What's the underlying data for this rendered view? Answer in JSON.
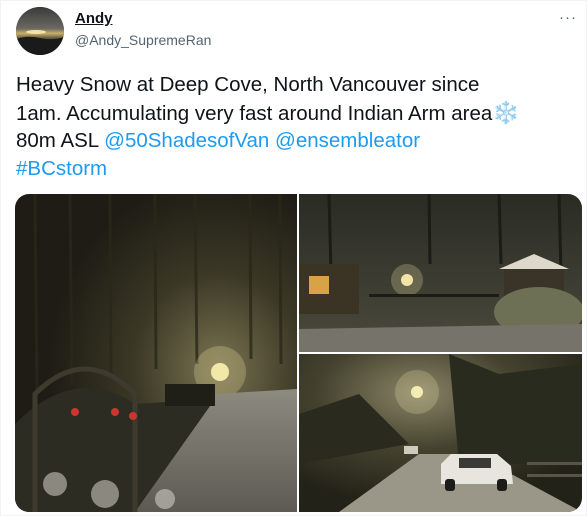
{
  "user": {
    "display_name": "Andy",
    "handle": "@Andy_SupremeRan"
  },
  "header": {
    "more_icon": "more-horizontal-icon",
    "more_glyph": "···"
  },
  "tweet": {
    "text_lines": [
      "Heavy Snow at Deep Cove, North Vancouver since",
      "1am. Accumulating very fast around Indian Arm area",
      "80m ASL"
    ],
    "emoji": "❄️",
    "mentions": [
      "@50ShadesofVan",
      "@ensembleator"
    ],
    "hashtags": [
      "#BCstorm"
    ]
  },
  "media": {
    "photos": [
      {
        "subject": "snowy-night-road-with-garden-arch",
        "icon": "photo-icon"
      },
      {
        "subject": "snowy-night-house-with-gazebo",
        "icon": "photo-icon"
      },
      {
        "subject": "snowy-night-street-with-parked-car",
        "icon": "photo-icon"
      }
    ]
  },
  "colors": {
    "link": "#1d9bf0",
    "text": "#0f1419",
    "secondary": "#536471"
  }
}
